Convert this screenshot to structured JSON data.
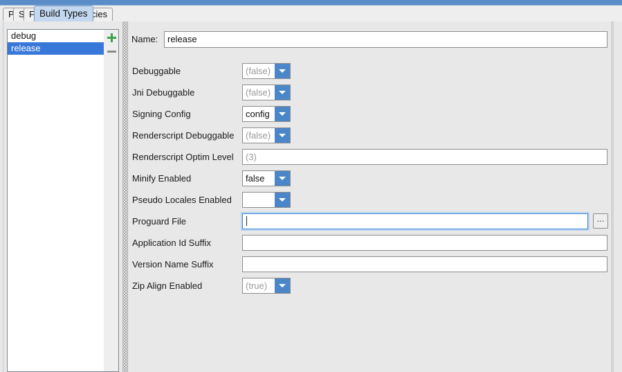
{
  "window": {
    "accent_blue": "#5b8dc8",
    "selection_blue": "#3778d9",
    "combo_button_blue": "#4a86c8"
  },
  "tabs": [
    {
      "label": "Properties",
      "active": false
    },
    {
      "label": "Signing",
      "active": false
    },
    {
      "label": "Flavors",
      "active": false
    },
    {
      "label": "Build Types",
      "active": true
    },
    {
      "label": "Dependencies",
      "active": false
    }
  ],
  "build_types_list": {
    "items": [
      {
        "label": "debug",
        "selected": false
      },
      {
        "label": "release",
        "selected": true
      }
    ],
    "add_button": "+",
    "remove_button": "–"
  },
  "form": {
    "name_label": "Name:",
    "name_value": "release",
    "rows": [
      {
        "label": "Debuggable",
        "kind": "combo",
        "value": "(false)",
        "placeholder": true
      },
      {
        "label": "Jni Debuggable",
        "kind": "combo",
        "value": "(false)",
        "placeholder": true
      },
      {
        "label": "Signing Config",
        "kind": "combo",
        "value": "config",
        "placeholder": false
      },
      {
        "label": "Renderscript Debuggable",
        "kind": "combo",
        "value": "(false)",
        "placeholder": true
      },
      {
        "label": "Renderscript Optim Level",
        "kind": "text",
        "value": "(3)",
        "placeholder": true
      },
      {
        "label": "Minify Enabled",
        "kind": "combo",
        "value": "false",
        "placeholder": false
      },
      {
        "label": "Pseudo Locales Enabled",
        "kind": "combo",
        "value": "",
        "placeholder": false
      },
      {
        "label": "Proguard File",
        "kind": "text-focused",
        "value": "",
        "placeholder": false
      },
      {
        "label": "Application Id Suffix",
        "kind": "text",
        "value": "",
        "placeholder": false
      },
      {
        "label": "Version Name Suffix",
        "kind": "text",
        "value": "",
        "placeholder": false
      },
      {
        "label": "Zip Align Enabled",
        "kind": "combo",
        "value": "(true)",
        "placeholder": true
      }
    ],
    "browse_button_label": "..."
  }
}
